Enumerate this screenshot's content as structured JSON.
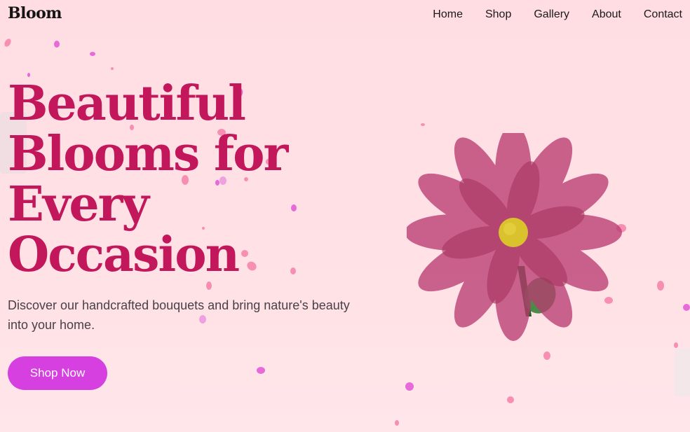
{
  "brand": {
    "logo": "Bloom"
  },
  "nav": {
    "items": [
      {
        "label": "Home"
      },
      {
        "label": "Shop"
      },
      {
        "label": "Gallery"
      },
      {
        "label": "About"
      },
      {
        "label": "Contact"
      }
    ]
  },
  "hero": {
    "title_lines": [
      "Beautiful",
      "Blooms for",
      "Every",
      "Occasion"
    ],
    "subtitle": "Discover our handcrafted bouquets and bring nature's beauty into your home.",
    "cta_label": "Shop Now"
  },
  "colors": {
    "background": "#ffdde3",
    "heading": "#c2185b",
    "cta": "#d63fe0",
    "petal_pink": "#f78fb3",
    "petal_magenta": "#d65ce0",
    "flower_petal": "#b93d72",
    "flower_center": "#d9c22c",
    "stem": "#1f5b1f"
  },
  "icons": {
    "flower": "flower-illustration",
    "petals": "falling-petals"
  }
}
